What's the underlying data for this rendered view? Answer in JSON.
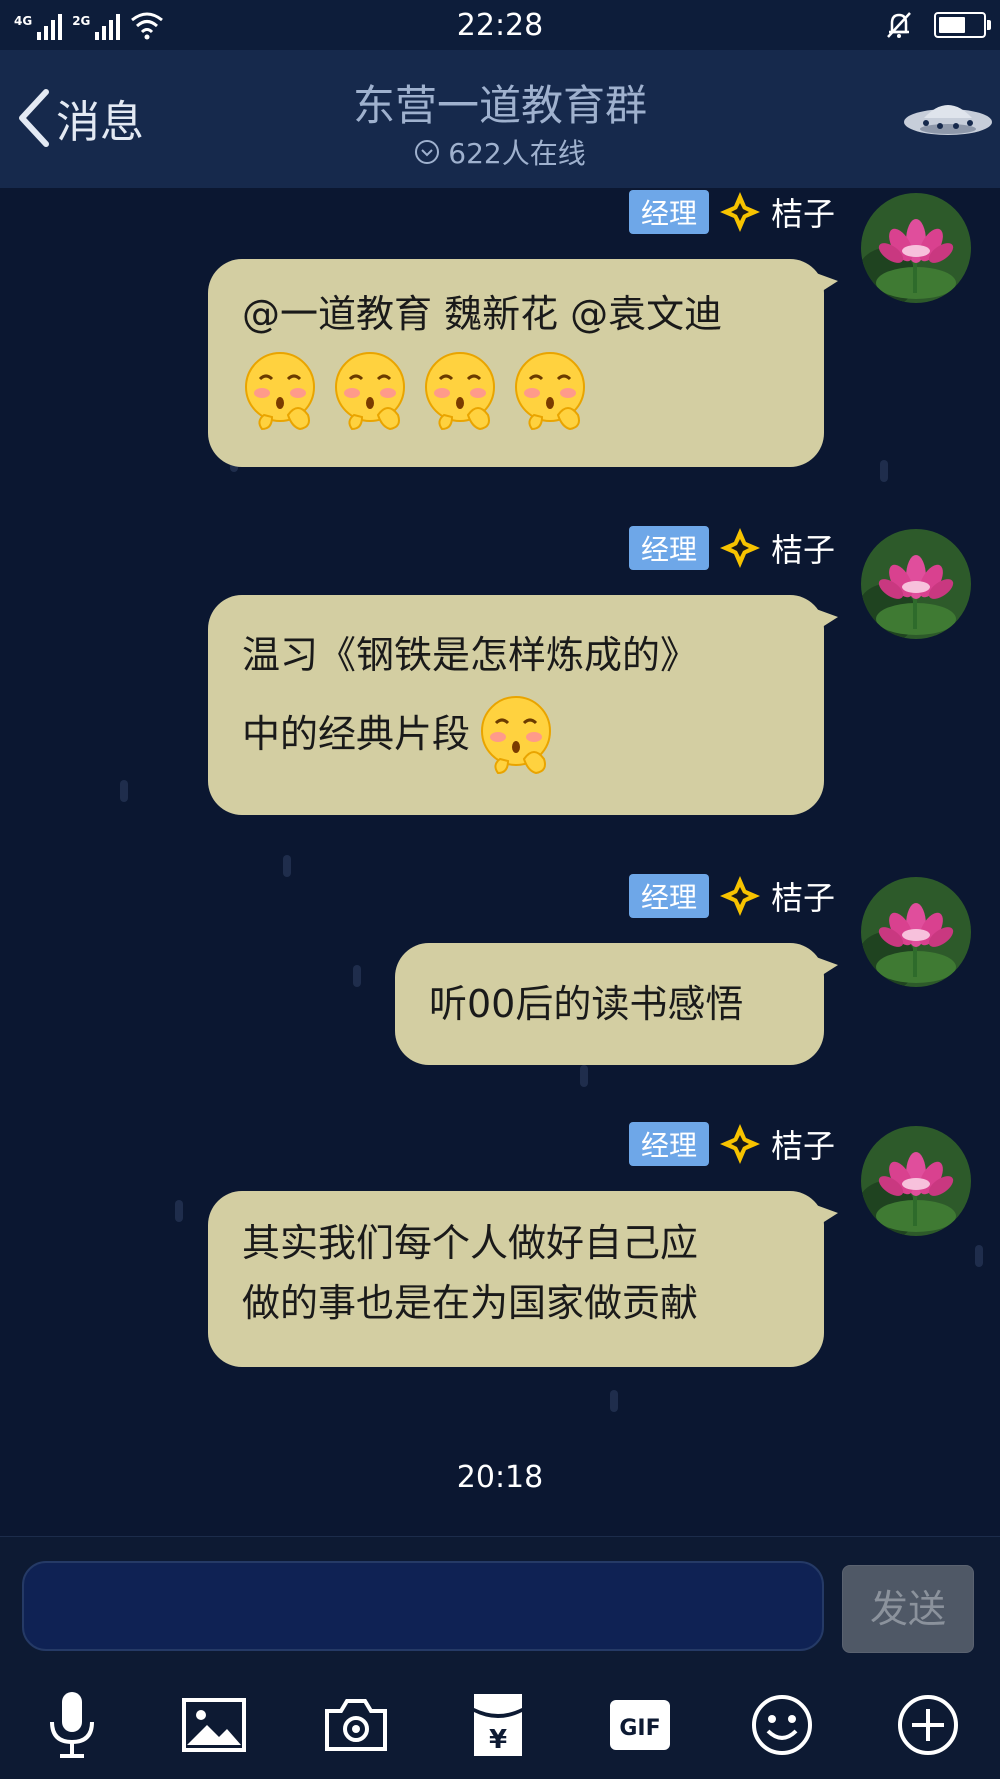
{
  "status_bar": {
    "signal1_label": "4G",
    "signal2_label": "2G",
    "time": "22:28"
  },
  "header": {
    "back_label": "消息",
    "title": "东营一道教育群",
    "online": "622人在线"
  },
  "messages": [
    {
      "role": "经理",
      "sender": "桔子",
      "line1": "@一道教育 魏新花 @袁文迪",
      "line2": "",
      "emoji_count": 4
    },
    {
      "role": "经理",
      "sender": "桔子",
      "line1": "温习《钢铁是怎样炼成的》",
      "line2": "中的经典片段",
      "emoji_count": 1
    },
    {
      "role": "经理",
      "sender": "桔子",
      "line1": "听00后的读书感悟",
      "line2": "",
      "emoji_count": 0
    },
    {
      "role": "经理",
      "sender": "桔子",
      "line1": "其实我们每个人做好自己应",
      "line2": "做的事也是在为国家做贡献",
      "emoji_count": 0
    }
  ],
  "timestamp": "20:18",
  "input": {
    "value": "",
    "send_label": "发送"
  },
  "toolbar": {
    "icons": [
      "microphone-icon",
      "image-icon",
      "camera-icon",
      "red-packet-icon",
      "gif-icon",
      "emoji-icon",
      "plus-icon"
    ],
    "gif_label": "GIF",
    "yen_label": "¥"
  },
  "colors": {
    "bubble": "#d3cea2",
    "role_badge": "#6ea7e8",
    "star": "#f7c300",
    "header": "#16294c",
    "background": "#0b1731"
  }
}
